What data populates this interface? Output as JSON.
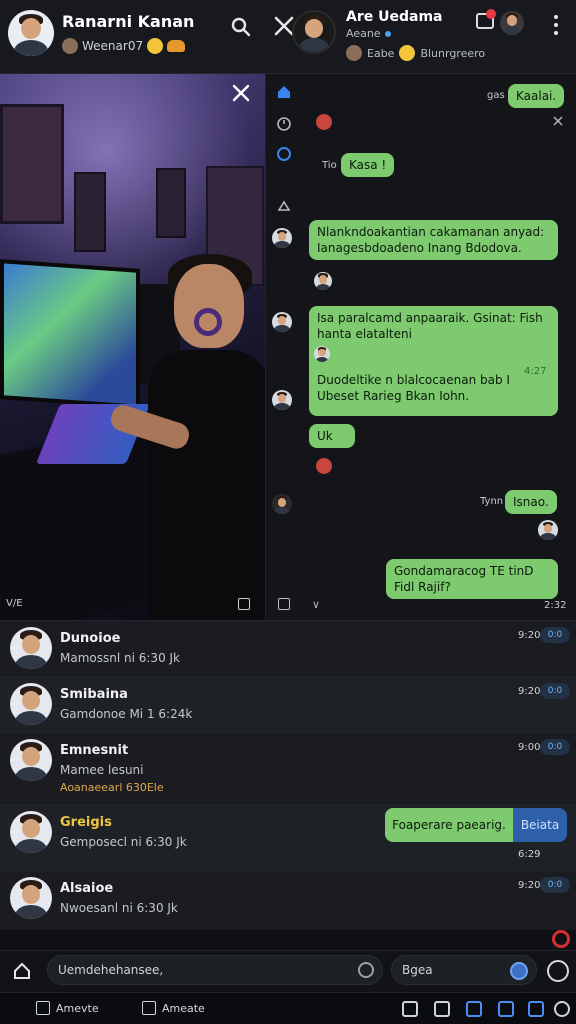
{
  "left_header": {
    "contact_name": "Ranarni Kanan",
    "status_text": "Weenar07"
  },
  "right_header": {
    "contact_name": "Are Uedama",
    "subtitle": "Aeane",
    "info_left": "Eabe",
    "info_right": "Blunrgreero"
  },
  "photo": {
    "footer_left": "V/E"
  },
  "chat": {
    "messages": [
      {
        "text": "Kaalai.",
        "time": "gas"
      },
      {
        "text": "Kasa !",
        "time": "Tio"
      },
      {
        "text": "Nlankndoakantian cakamanan anyad: Ianagesbdoadeno Inang Bdodova.",
        "time": ""
      },
      {
        "text": "Isa paralcamd anpaaraik. Gsinat: Fish hanta elatalteni",
        "time": ""
      },
      {
        "text": "Duodeltike n blalcocaenan bab I Ubeset Rarieg Bkan Iohn.",
        "time": "4:27"
      },
      {
        "text": "Uk",
        "time": ""
      },
      {
        "text": "Isnao.",
        "time": "Tynn"
      },
      {
        "text": "Gondamaracog TE tinD Fidl Rajif?",
        "time": "2:32"
      }
    ]
  },
  "list": {
    "rows": [
      {
        "name": "Dunoioe",
        "preview": "Mamossnl ni 6:30 Jk",
        "time": "9:20",
        "chip": "0:0"
      },
      {
        "name": "Smibaina",
        "preview": "Gamdonoe Mi 1 6:24k",
        "time": "9:20",
        "chip": "0:0"
      },
      {
        "name": "Emnesnit",
        "preview": "Mamee lesuni",
        "sub": "Aoanaeearl 630Ele",
        "time": "9:00",
        "chip": "0:0"
      },
      {
        "name": "Greigis",
        "preview": "Gemposecl ni 6:30 Jk",
        "time": "6:29",
        "chip": ""
      },
      {
        "name": "Alsaioe",
        "preview": "Nwoesanl ni 6:30 Jk",
        "time": "9:20",
        "chip": "0:0"
      }
    ],
    "bubble_text": "Foaperare paearig.",
    "bubble_button": "Beiata"
  },
  "composer": {
    "input_value": "Uemdehehansee,",
    "secondary_input": "Bgea"
  },
  "bottom_bar": {
    "left_label": "Amevte",
    "mid_label": "Ameate"
  }
}
